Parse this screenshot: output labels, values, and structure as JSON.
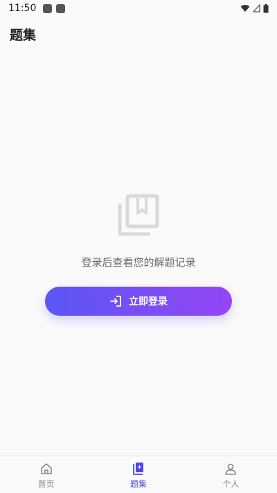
{
  "status_bar": {
    "time": "11:50",
    "icons": [
      "notification-square-icon",
      "notification-square-icon",
      "wifi-icon",
      "signal-icon",
      "battery-icon"
    ]
  },
  "header": {
    "title": "题集"
  },
  "empty_state": {
    "icon": "book-bookmark-icon",
    "message": "登录后查看您的解题记录"
  },
  "login_button": {
    "label": "立即登录",
    "icon": "login-arrow-icon"
  },
  "tabbar": {
    "tabs": [
      {
        "label": "首页",
        "icon": "home-icon",
        "active": false
      },
      {
        "label": "题集",
        "icon": "question-set-icon",
        "active": true
      },
      {
        "label": "个人",
        "icon": "person-icon",
        "active": false
      }
    ]
  },
  "colors": {
    "accent": "#4f46e5",
    "button_gradient_start": "#5a56f5",
    "button_gradient_end": "#9646f6",
    "background": "#fafafa"
  }
}
